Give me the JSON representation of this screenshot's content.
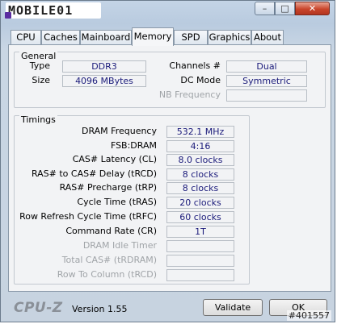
{
  "window": {
    "logo_text": "MOBILE01",
    "buttons": {
      "minimize": "–",
      "maximize": "□",
      "close": "✕"
    }
  },
  "tabs": [
    {
      "label": "CPU"
    },
    {
      "label": "Caches"
    },
    {
      "label": "Mainboard"
    },
    {
      "label": "Memory",
      "active": true
    },
    {
      "label": "SPD"
    },
    {
      "label": "Graphics"
    },
    {
      "label": "About"
    }
  ],
  "general": {
    "title": "General",
    "type_label": "Type",
    "type_value": "DDR3",
    "size_label": "Size",
    "size_value": "4096 MBytes",
    "channels_label": "Channels #",
    "channels_value": "Dual",
    "dcmode_label": "DC Mode",
    "dcmode_value": "Symmetric",
    "nbfreq_label": "NB Frequency",
    "nbfreq_value": ""
  },
  "timings": {
    "title": "Timings",
    "rows": [
      {
        "label": "DRAM Frequency",
        "value": "532.1 MHz"
      },
      {
        "label": "FSB:DRAM",
        "value": "4:16"
      },
      {
        "label": "CAS# Latency (CL)",
        "value": "8.0 clocks"
      },
      {
        "label": "RAS# to CAS# Delay (tRCD)",
        "value": "8 clocks"
      },
      {
        "label": "RAS# Precharge (tRP)",
        "value": "8 clocks"
      },
      {
        "label": "Cycle Time (tRAS)",
        "value": "20 clocks"
      },
      {
        "label": "Row Refresh Cycle Time (tRFC)",
        "value": "60 clocks"
      },
      {
        "label": "Command Rate (CR)",
        "value": "1T"
      },
      {
        "label": "DRAM Idle Timer",
        "value": ""
      },
      {
        "label": "Total CAS# (tRDRAM)",
        "value": ""
      },
      {
        "label": "Row To Column (tRCD)",
        "value": ""
      }
    ]
  },
  "footer": {
    "brand": "CPU-Z",
    "version": "Version 1.55",
    "validate_label": "Validate",
    "ok_label": "OK",
    "watermark": "#401557"
  }
}
